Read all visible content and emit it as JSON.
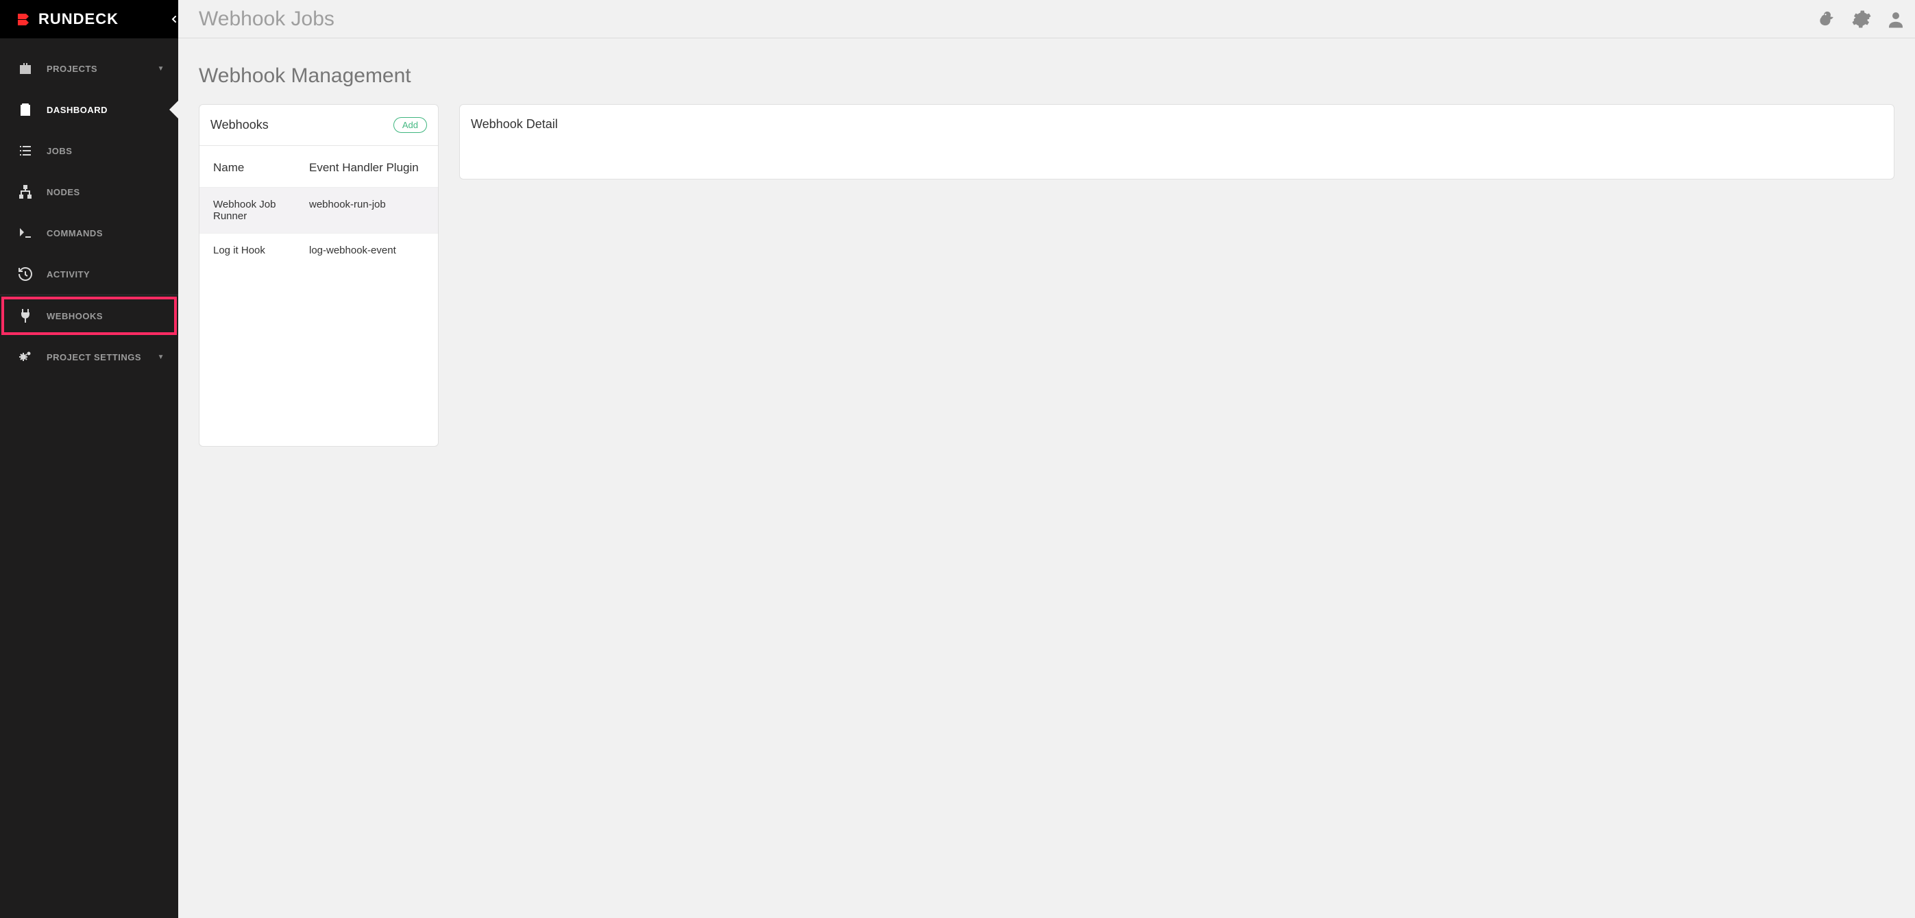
{
  "brand": {
    "name": "RUNDECK"
  },
  "sidebar": {
    "items": [
      {
        "label": "PROJECTS",
        "hasCaret": true
      },
      {
        "label": "DASHBOARD",
        "hasCaret": false,
        "active": true
      },
      {
        "label": "JOBS",
        "hasCaret": false
      },
      {
        "label": "NODES",
        "hasCaret": false
      },
      {
        "label": "COMMANDS",
        "hasCaret": false
      },
      {
        "label": "ACTIVITY",
        "hasCaret": false
      },
      {
        "label": "WEBHOOKS",
        "hasCaret": false,
        "highlight": true
      },
      {
        "label": "PROJECT SETTINGS",
        "hasCaret": true
      }
    ]
  },
  "topbar": {
    "title": "Webhook Jobs"
  },
  "page": {
    "title": "Webhook Management",
    "webhooks": {
      "heading": "Webhooks",
      "addLabel": "Add",
      "columns": {
        "name": "Name",
        "handler": "Event Handler Plugin"
      },
      "rows": [
        {
          "name": "Webhook Job Runner",
          "handler": "webhook-run-job",
          "selected": true
        },
        {
          "name": "Log it Hook",
          "handler": "log-webhook-event",
          "selected": false
        }
      ]
    },
    "detail": {
      "heading": "Webhook Detail"
    }
  }
}
